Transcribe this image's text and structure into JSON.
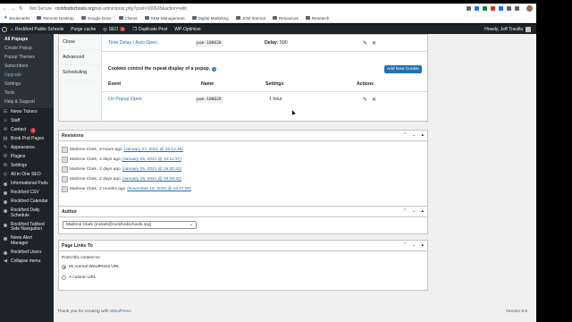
{
  "browser": {
    "security_label": "Not Secure",
    "url_host": "rockfordschools.org",
    "url_path": "/wp-admin/post.php?post=100628&action=edit",
    "bookmarks": [
      {
        "label": "Bookmarks",
        "icon": "star-icon"
      },
      {
        "label": "Remote Desktop",
        "icon": "folder-icon"
      },
      {
        "label": "Google Drive",
        "icon": "folder-icon"
      },
      {
        "label": "Clients",
        "icon": "folder-icon"
      },
      {
        "label": "SEM Management",
        "icon": "folder-icon"
      },
      {
        "label": "Digital Marketing",
        "icon": "folder-icon"
      },
      {
        "label": "JCM Internal",
        "icon": "folder-icon"
      },
      {
        "label": "Resources",
        "icon": "folder-icon"
      },
      {
        "label": "Research",
        "icon": "folder-icon"
      }
    ]
  },
  "adminbar": {
    "site_name": "Rockford Public Schools",
    "purge": "Purge cache",
    "seo": "SEO",
    "seo_count": "1",
    "duplicate": "Duplicate Post",
    "optimize": "WP-Optimize",
    "howdy": "Howdy, Jeff Travilla"
  },
  "sidebar": {
    "submenu": [
      {
        "label": "All Popups",
        "kind": "current"
      },
      {
        "label": "Create Popup",
        "kind": ""
      },
      {
        "label": "Popup Themes",
        "kind": ""
      },
      {
        "label": "Subscribers",
        "kind": ""
      },
      {
        "label": "Upgrade",
        "kind": "upgrade"
      },
      {
        "label": "Settings",
        "kind": ""
      },
      {
        "label": "Tools",
        "kind": ""
      },
      {
        "label": "Help & Support",
        "kind": ""
      }
    ],
    "items": [
      {
        "label": "News Tickers",
        "icon": "ticker-icon"
      },
      {
        "label": "Staff",
        "icon": "staff-icon"
      },
      {
        "label": "Contact",
        "icon": "contact-icon",
        "badge": "1"
      },
      {
        "label": "Book Pod Pages",
        "icon": "book-icon"
      },
      {
        "label": "Appearance",
        "icon": "appearance-icon"
      },
      {
        "label": "Plugins",
        "icon": "plugins-icon"
      },
      {
        "label": "Settings",
        "icon": "settings-icon"
      },
      {
        "label": "All in One SEO",
        "icon": "seo-icon"
      },
      {
        "label": "Informational Pods",
        "icon": "pods-icon"
      },
      {
        "label": "Rockford CSV",
        "icon": "csv-icon"
      },
      {
        "label": "Rockford Calendar",
        "icon": "calendar-icon"
      },
      {
        "label": "Rockford Daily Schedule",
        "icon": "schedule-icon"
      },
      {
        "label": "Rockford Tabbed Side Navigation",
        "icon": "tabs-icon"
      },
      {
        "label": "News Alert Manager",
        "icon": "alert-icon"
      },
      {
        "label": "Rockford Users",
        "icon": "users-icon"
      },
      {
        "label": "Collapse menu",
        "icon": "collapse-icon"
      }
    ]
  },
  "popup_settings": {
    "tabs": [
      "Close",
      "Advanced",
      "Scheduling"
    ],
    "trigger_row": {
      "name": "Time Delay / Auto Open",
      "code": "pum-100628",
      "delay_label": "Delay:",
      "delay_value": "500"
    },
    "cookies_text": "Cookies control the repeat display of a popup.",
    "add_cookie": "Add New Cookie",
    "headers": {
      "event": "Event",
      "name": "Name",
      "settings": "Settings",
      "actions": "Actions"
    },
    "cookie_row": {
      "event": "On Popup Open",
      "name": "pum-100628",
      "settings": "1 hour"
    },
    "edit_icon": "✎",
    "delete_icon": "✕"
  },
  "revisions": {
    "title": "Revisions",
    "items": [
      {
        "author": "Marlene Clark,",
        "ago": "9 hours ago",
        "date": "(January 27, 2021 @ 15:12:46)"
      },
      {
        "author": "Marlene Clark,",
        "ago": "2 days ago",
        "date": "(January 26, 2021 @ 10:11:37)"
      },
      {
        "author": "Marlene Clark,",
        "ago": "2 days ago",
        "date": "(January 25, 2021 @ 19:30:42)"
      },
      {
        "author": "Marlene Clark,",
        "ago": "2 days ago",
        "date": "(January 25, 2021 @ 19:29:42)"
      },
      {
        "author": "Marlene Clark,",
        "ago": "2 months ago",
        "date": "(November 18, 2020 @ 19:47:00)"
      }
    ]
  },
  "author": {
    "title": "Author",
    "selected": "Marlene Clark (mclark@rockfordschools.org)"
  },
  "page_links": {
    "title": "Page Links To",
    "prompt": "Point this content to:",
    "options": [
      {
        "label": "Its normal WordPress URL",
        "checked": true
      },
      {
        "label": "A custom URL",
        "checked": false
      }
    ]
  },
  "footer": {
    "thanks": "Thank you for creating with",
    "wordpress": "WordPress",
    "version": "Version 5.6"
  },
  "box_controls": {
    "up": "⌃",
    "down": "⌄",
    "toggle": "▴"
  }
}
